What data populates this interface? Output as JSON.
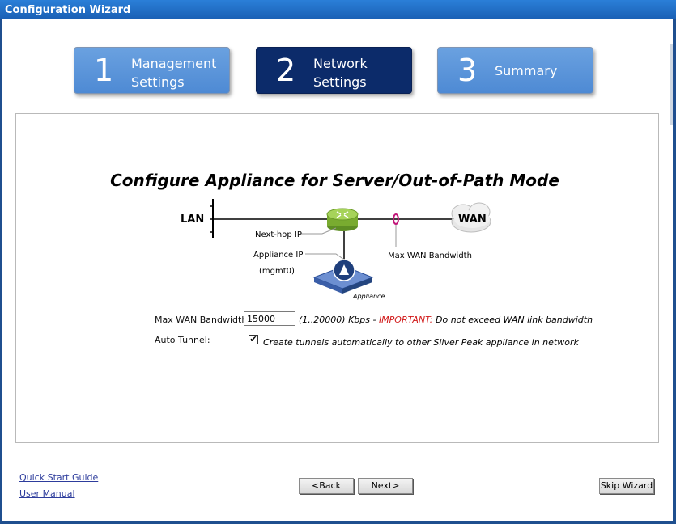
{
  "window": {
    "title": "Configuration Wizard"
  },
  "steps": [
    {
      "number": "1",
      "line1": "Management",
      "line2": "Settings",
      "state": "inactive"
    },
    {
      "number": "2",
      "line1": "Network",
      "line2": "Settings",
      "state": "active"
    },
    {
      "number": "3",
      "label": "Summary",
      "state": "inactive"
    }
  ],
  "main": {
    "heading": "Configure Appliance for Server/Out-of-Path Mode",
    "diagram": {
      "lan": "LAN",
      "wan": "WAN",
      "next_hop": "Next-hop IP",
      "appliance_ip": "Appliance IP",
      "mgmt": "(mgmt0)",
      "max_wan_label": "Max WAN Bandwidth",
      "appliance": "Appliance"
    },
    "bandwidth": {
      "label": "Max WAN Bandwidth:",
      "value": "15000",
      "range": "(1..20000) Kbps - ",
      "important": "IMPORTANT:",
      "note": " Do not exceed WAN link bandwidth"
    },
    "auto_tunnel": {
      "label": "Auto Tunnel:",
      "checked": true,
      "check_mark": "✔",
      "description": "Create tunnels automatically to other Silver Peak appliance in network"
    }
  },
  "footer": {
    "quick_start": "Quick Start Guide",
    "user_manual": "User Manual",
    "back": "<Back",
    "next": "Next>",
    "skip": "Skip Wizard"
  },
  "colors": {
    "active_step": "#0c2b6a",
    "inactive_step": "#5b95da",
    "important": "#d11a1a",
    "router": "#8fc13a",
    "loop": "#c2187a"
  }
}
